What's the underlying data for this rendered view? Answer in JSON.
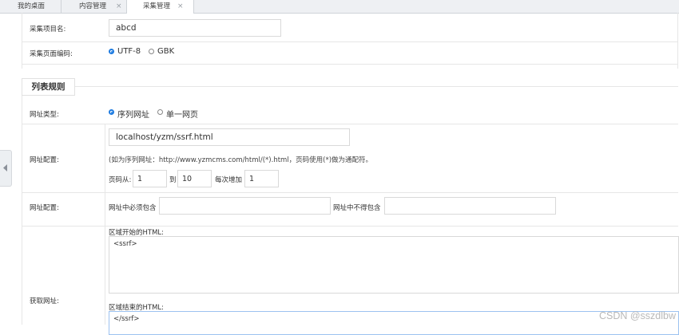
{
  "tabs": [
    {
      "label": "我的桌面",
      "closable": false
    },
    {
      "label": "内容管理",
      "closable": true
    },
    {
      "label": "采集管理",
      "closable": true,
      "active": true
    }
  ],
  "close_glyph": "×",
  "form": {
    "project_name": {
      "label": "采集项目名:",
      "value": "abcd"
    },
    "encoding": {
      "label": "采集页面编码:",
      "options": [
        "UTF-8",
        "GBK"
      ],
      "selected": "UTF-8"
    },
    "section_title": "列表规则",
    "url_type": {
      "label": "网址类型:",
      "options": [
        "序列网址",
        "单一网页"
      ],
      "selected": "序列网址"
    },
    "url_config": {
      "label": "网址配置:",
      "url_value": "localhost/yzm/ssrf.html",
      "hint": "(如为序列网址：http://www.yzmcms.com/html/(*).html，页码使用(*)做为通配符。",
      "page_from_label": "页码从:",
      "page_from": "1",
      "page_to_label": "到",
      "page_to": "10",
      "step_label": "每次增加",
      "step": "1"
    },
    "url_filter": {
      "label": "网址配置:",
      "must_contain_label": "网址中必须包含",
      "must_contain": "",
      "not_contain_label": "网址中不得包含",
      "not_contain": ""
    },
    "fetch_url": {
      "label": "获取网址:",
      "start_label": "区域开始的HTML:",
      "start_value": "<ssrf>",
      "end_label": "区域结束的HTML:",
      "end_value": "</ssrf>"
    }
  },
  "icons": {
    "collapse": "chevron-left-icon"
  },
  "colors": {
    "accent": "#1e7be0",
    "border": "#d9d9d9",
    "tabbar": "#eef0f3"
  },
  "watermark": "CSDN @sszdlbw"
}
